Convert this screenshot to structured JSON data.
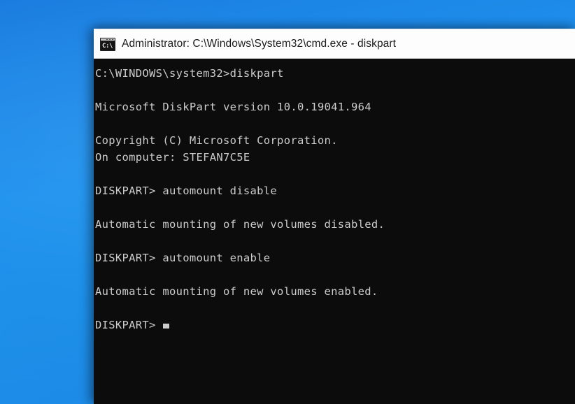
{
  "desktop": {
    "background_color_top": "#1a7cdf",
    "background_color_mid": "#1f93ef",
    "background_color_bottom": "#1a84e4"
  },
  "window": {
    "title": "Administrator: C:\\Windows\\System32\\cmd.exe - diskpart",
    "icon_name": "cmd-exe-icon",
    "icon_glyph": "C:\\",
    "titlebar_background": "#fdfdfd",
    "titlebar_text_color": "#1b1b1b",
    "console_background": "#0c0c0c",
    "console_text_color": "#cccccc"
  },
  "console": {
    "lines": [
      "C:\\WINDOWS\\system32>diskpart",
      "",
      "Microsoft DiskPart version 10.0.19041.964",
      "",
      "Copyright (C) Microsoft Corporation.",
      "On computer: STEFAN7C5E",
      "",
      "DISKPART> automount disable",
      "",
      "Automatic mounting of new volumes disabled.",
      "",
      "DISKPART> automount enable",
      "",
      "Automatic mounting of new volumes enabled.",
      "",
      "DISKPART> "
    ],
    "prompt": "DISKPART> ",
    "cursor_visible": true,
    "cursor_style": "underscore-block"
  },
  "details": {
    "working_directory": "C:\\WINDOWS\\system32",
    "program_invoked": "diskpart",
    "diskpart_version": "10.0.19041.964",
    "copyright": "Copyright (C) Microsoft Corporation.",
    "computer_name": "STEFAN7C5E",
    "commands_run": [
      "automount disable",
      "automount enable"
    ],
    "results": [
      "Automatic mounting of new volumes disabled.",
      "Automatic mounting of new volumes enabled."
    ]
  }
}
